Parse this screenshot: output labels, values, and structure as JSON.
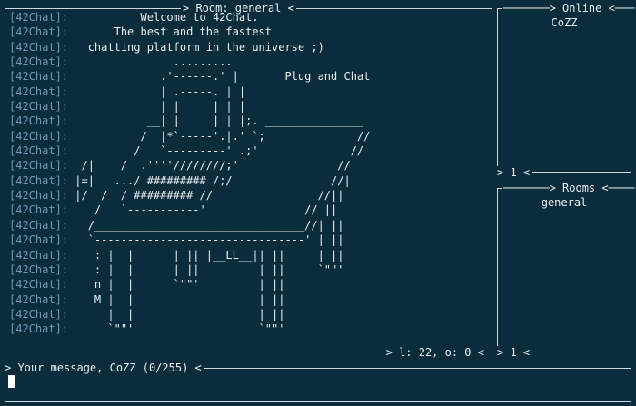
{
  "chat": {
    "room_title": "Room: general",
    "footer": "l: 22, o: 0",
    "messages": [
      {
        "tag": "[42Chat]:",
        "text": "           Welcome to 42Chat."
      },
      {
        "tag": "[42Chat]:",
        "text": "       The best and the fastest"
      },
      {
        "tag": "[42Chat]:",
        "text": "   chatting platform in the universe ;)"
      },
      {
        "tag": "[42Chat]:",
        "text": "                .........  "
      },
      {
        "tag": "[42Chat]:",
        "text": "              .'------.' |       Plug and Chat"
      },
      {
        "tag": "[42Chat]:",
        "text": "              | .-----. | |"
      },
      {
        "tag": "[42Chat]:",
        "text": "              | |     | | |"
      },
      {
        "tag": "[42Chat]:",
        "text": "            __| |     | | |;. _______________"
      },
      {
        "tag": "[42Chat]:",
        "text": "           /  |*`-----'.|.' `;              //"
      },
      {
        "tag": "[42Chat]:",
        "text": "          /   `---------' .;'              //"
      },
      {
        "tag": "[42Chat]:",
        "text": "  /|    /  .''''////////;'               //"
      },
      {
        "tag": "[42Chat]:",
        "text": " |=|   .../ ######### /;/               //|"
      },
      {
        "tag": "[42Chat]:",
        "text": " |/  /  / ######### //                //||"
      },
      {
        "tag": "[42Chat]:",
        "text": "    /   `-----------'               // ||"
      },
      {
        "tag": "[42Chat]:",
        "text": "   /________________________________//| ||"
      },
      {
        "tag": "[42Chat]:",
        "text": "   `--------------------------------' | ||"
      },
      {
        "tag": "[42Chat]:",
        "text": "    : | ||      | || |__LL__|| ||     | ||"
      },
      {
        "tag": "[42Chat]:",
        "text": "    : | ||      | ||         | ||     `\"\"'"
      },
      {
        "tag": "[42Chat]:",
        "text": "    n | ||      `\"\"'         | ||"
      },
      {
        "tag": "[42Chat]:",
        "text": "    M | ||                   | ||"
      },
      {
        "tag": "[42Chat]:",
        "text": "      | ||                   | ||"
      },
      {
        "tag": "[42Chat]:",
        "text": "      `\"\"'                   `\"\"'"
      }
    ]
  },
  "online": {
    "title": "Online",
    "users": [
      "CoZZ"
    ],
    "footer": "1"
  },
  "rooms": {
    "title": "Rooms",
    "items": [
      "general"
    ],
    "footer": "1"
  },
  "input": {
    "title": "Your message, CoZZ (0/255)",
    "value": ""
  },
  "colors": {
    "background": "#0b2c3c",
    "tag": "#6f98b5",
    "border": "#cfd8dc",
    "text": "#e8eef0"
  }
}
